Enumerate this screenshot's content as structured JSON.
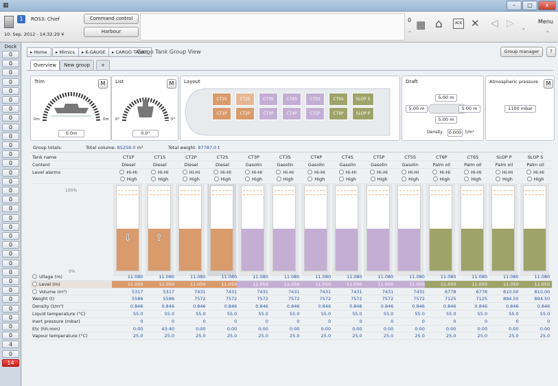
{
  "window": {
    "min": "–",
    "max": "□",
    "close": "x"
  },
  "header": {
    "station_number": "1",
    "station_name": "ROS3: Chief",
    "datetime": "10. Sep. 2012 - 14:32:29",
    "datetime_drop": "¥",
    "command_control": "Command control",
    "harbour": "Harbour",
    "alarm_count": "0",
    "menu_label": "Menu"
  },
  "sidebar": {
    "dock": "Dock",
    "items": [
      "0",
      "0",
      "0",
      "0",
      "0",
      "0",
      "0",
      "0",
      "0",
      "0",
      "0",
      "0",
      "0",
      "0",
      "0",
      "0",
      "0",
      "0",
      "0",
      "0",
      "0",
      "0",
      "0",
      "0",
      "0",
      "0",
      "0",
      "0",
      "0",
      "0",
      "0",
      "0",
      "4",
      "0",
      "14",
      "12",
      "0"
    ]
  },
  "breadcrumb": [
    "Home",
    "Mimics",
    "K-GAUGE",
    "CARGO TANKS"
  ],
  "view_title": "Cargo Tank Group View",
  "group_manager": "Group manager",
  "help": "?",
  "tabs": [
    "Overview",
    "New group",
    "+"
  ],
  "trim": {
    "title": "Trim",
    "value": "0.0",
    "unit": "m",
    "label_l": "0m",
    "label_r": "0m",
    "m": "M"
  },
  "list": {
    "title": "List",
    "value": "0.0",
    "unit": "°",
    "label_l": "0°",
    "label_r": "0°",
    "m": "M"
  },
  "layout": {
    "title": "Layout",
    "top": [
      "CT1S",
      "CT2S",
      "CT3S",
      "CT4S",
      "CT5S",
      "CT6S",
      "SLOP S"
    ],
    "bottom": [
      "CT1P",
      "CT2P",
      "CT3P",
      "CT4P",
      "CT5P",
      "CT6P",
      "SLOP P"
    ]
  },
  "draft": {
    "title": "Draft",
    "top": "5.00",
    "left": "5.00",
    "right": "5.00",
    "bottom": "5.00",
    "unit": "m",
    "density_label": "Density",
    "density": "0.000",
    "density_unit": "t/m³"
  },
  "atmos": {
    "title": "Atmospheric pressure",
    "value": "1100",
    "unit": "mbar",
    "m": "M"
  },
  "totals": {
    "group_label": "Group totals:",
    "vol_label": "Total volume:",
    "vol": "85258.0",
    "vol_unit": "m³",
    "wt_label": "Total weight:",
    "wt": "87787.0",
    "wt_unit": "t"
  },
  "colors": {
    "orange": "#d99a6c",
    "purple": "#c4aed4",
    "olive": "#9ea36a"
  },
  "scale": {
    "top": "100%",
    "bottom": "0%"
  },
  "table": {
    "row_labels": {
      "name": "Tank name",
      "content": "Content",
      "alarms": "Level alarms",
      "ullage": "Ullage (m)",
      "level": "Level (m)",
      "volume": "Volume (m³)",
      "weight": "Weight (t)",
      "density": "Density (t/m³)",
      "liqtemp": "Liquid temperature (°C)",
      "inert": "Inert pressure (mbar)",
      "etc": "Etc (hh:mm)",
      "vaptemp": "Vapour temperature (°C)"
    },
    "alarm_hihi": "Hi-Hi",
    "alarm_high": "High",
    "tanks": [
      {
        "name": "CT1P",
        "content": "Diesel",
        "ullage": "11.080",
        "level": "11.050",
        "volume": "5317",
        "weight": "5586",
        "density": "0.846",
        "liqtemp": "55.0",
        "inert": "0",
        "etc": "0:00",
        "vaptemp": "25.0",
        "color": "orange",
        "fill": 0.5,
        "arrow": "⇩"
      },
      {
        "name": "CT1S",
        "content": "Diesel",
        "ullage": "11.080",
        "level": "11.050",
        "volume": "5317",
        "weight": "5586",
        "density": "0.846",
        "liqtemp": "55.0",
        "inert": "0",
        "etc": "43:40",
        "vaptemp": "25.0",
        "color": "orange",
        "fill": 0.5,
        "arrow": "⇧"
      },
      {
        "name": "CT2P",
        "content": "Diesel",
        "ullage": "11.080",
        "level": "11.050",
        "volume": "7431",
        "weight": "7572",
        "density": "0.846",
        "liqtemp": "55.0",
        "inert": "0",
        "etc": "0:00",
        "vaptemp": "25.0",
        "color": "orange",
        "fill": 0.5,
        "arrow": ""
      },
      {
        "name": "CT2S",
        "content": "Diesel",
        "ullage": "11.080",
        "level": "11.050",
        "volume": "7431",
        "weight": "7572",
        "density": "0.846",
        "liqtemp": "55.0",
        "inert": "0",
        "etc": "0:00",
        "vaptemp": "25.0",
        "color": "orange",
        "fill": 0.5,
        "arrow": ""
      },
      {
        "name": "CT3P",
        "content": "Gasolin",
        "ullage": "11.080",
        "level": "11.050",
        "volume": "7431",
        "weight": "7572",
        "density": "0.846",
        "liqtemp": "55.0",
        "inert": "0",
        "etc": "0:00",
        "vaptemp": "25.0",
        "color": "purple",
        "fill": 0.5,
        "arrow": ""
      },
      {
        "name": "CT3S",
        "content": "Gasolin",
        "ullage": "11.080",
        "level": "11.050",
        "volume": "7431",
        "weight": "7572",
        "density": "0.846",
        "liqtemp": "55.0",
        "inert": "0",
        "etc": "0:00",
        "vaptemp": "25.0",
        "color": "purple",
        "fill": 0.5,
        "arrow": ""
      },
      {
        "name": "CT4P",
        "content": "Gasolin",
        "ullage": "11.080",
        "level": "11.050",
        "volume": "7431",
        "weight": "7572",
        "density": "0.846",
        "liqtemp": "55.0",
        "inert": "0",
        "etc": "0:00",
        "vaptemp": "25.0",
        "color": "purple",
        "fill": 0.5,
        "arrow": ""
      },
      {
        "name": "CT4S",
        "content": "Gasolin",
        "ullage": "11.080",
        "level": "11.050",
        "volume": "7431",
        "weight": "7572",
        "density": "0.846",
        "liqtemp": "55.0",
        "inert": "0",
        "etc": "0:00",
        "vaptemp": "25.0",
        "color": "purple",
        "fill": 0.5,
        "arrow": ""
      },
      {
        "name": "CT5P",
        "content": "Gasolin",
        "ullage": "11.080",
        "level": "11.050",
        "volume": "7431",
        "weight": "7572",
        "density": "0.846",
        "liqtemp": "55.0",
        "inert": "0",
        "etc": "0:00",
        "vaptemp": "25.0",
        "color": "purple",
        "fill": 0.5,
        "arrow": ""
      },
      {
        "name": "CT5S",
        "content": "Gasolin",
        "ullage": "11.080",
        "level": "11.050",
        "volume": "7431",
        "weight": "7572",
        "density": "0.846",
        "liqtemp": "55.0",
        "inert": "0",
        "etc": "0:00",
        "vaptemp": "25.0",
        "color": "purple",
        "fill": 0.5,
        "arrow": ""
      },
      {
        "name": "CT6P",
        "content": "Palm oil",
        "ullage": "11.080",
        "level": "11.050",
        "volume": "6778",
        "weight": "7125",
        "density": "0.846",
        "liqtemp": "55.0",
        "inert": "0",
        "etc": "0:00",
        "vaptemp": "25.0",
        "color": "olive",
        "fill": 0.5,
        "arrow": ""
      },
      {
        "name": "CT6S",
        "content": "Palm oil",
        "ullage": "11.080",
        "level": "11.050",
        "volume": "6778",
        "weight": "7125",
        "density": "0.846",
        "liqtemp": "55.0",
        "inert": "0",
        "etc": "0:00",
        "vaptemp": "25.0",
        "color": "olive",
        "fill": 0.5,
        "arrow": ""
      },
      {
        "name": "SLOP P",
        "content": "Palm oil",
        "ullage": "11.080",
        "level": "11.050",
        "volume": "810.00",
        "weight": "894.50",
        "density": "0.846",
        "liqtemp": "55.0",
        "inert": "0",
        "etc": "0:00",
        "vaptemp": "25.0",
        "color": "olive",
        "fill": 0.5,
        "arrow": ""
      },
      {
        "name": "SLOP S",
        "content": "Palm oil",
        "ullage": "11.080",
        "level": "11.050",
        "volume": "810.00",
        "weight": "894.50",
        "density": "0.846",
        "liqtemp": "55.0",
        "inert": "0",
        "etc": "0:00",
        "vaptemp": "25.0",
        "color": "olive",
        "fill": 0.5,
        "arrow": ""
      }
    ]
  }
}
